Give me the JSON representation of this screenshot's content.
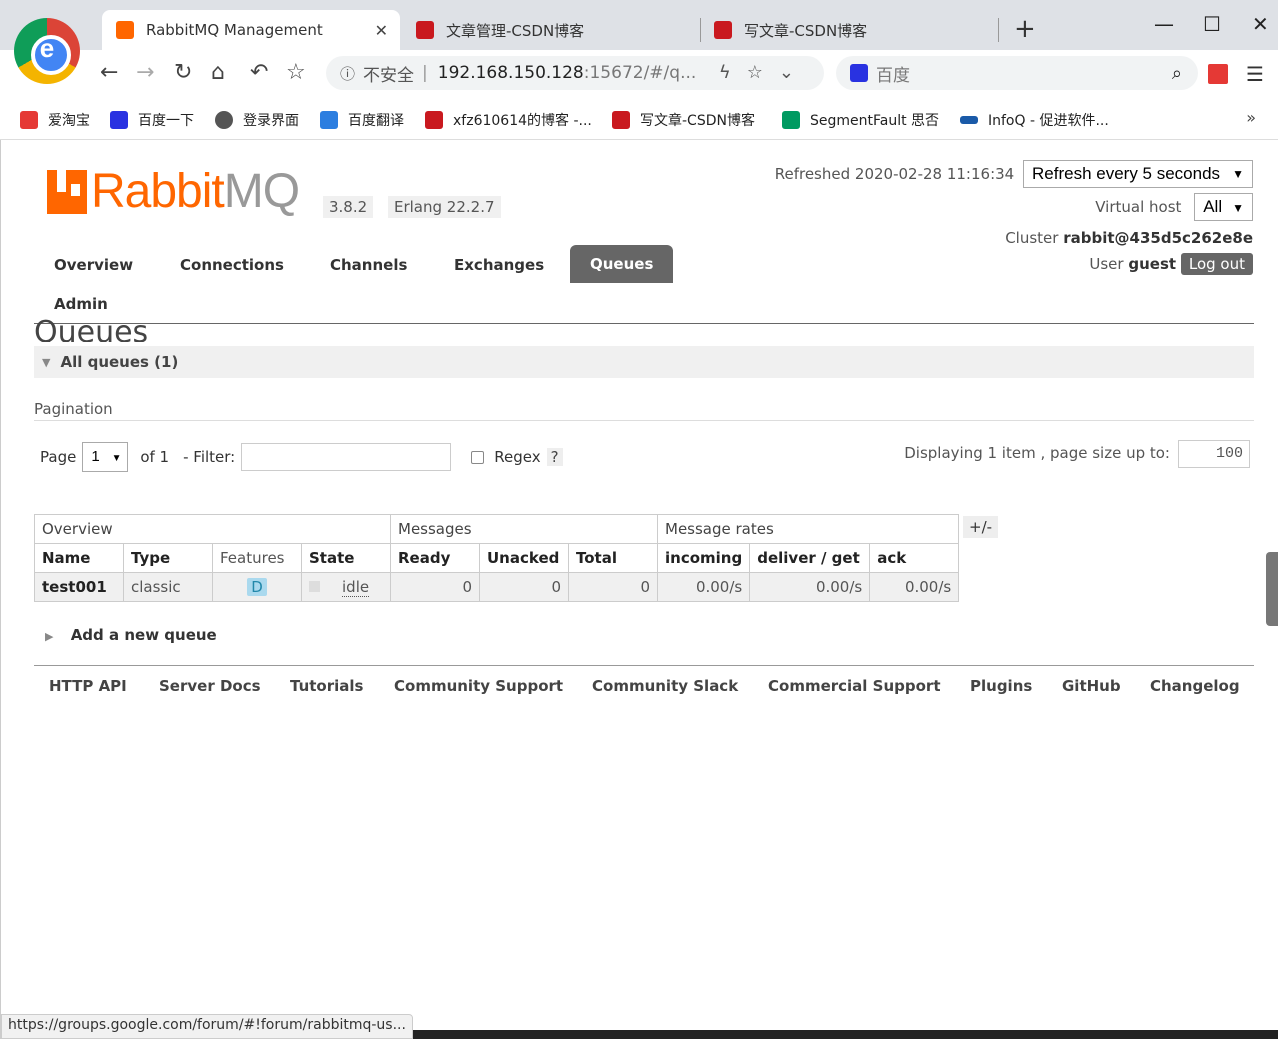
{
  "browser": {
    "tabs": [
      {
        "title": "RabbitMQ Management",
        "active": true
      },
      {
        "title": "文章管理-CSDN博客",
        "active": false
      },
      {
        "title": "写文章-CSDN博客",
        "active": false
      }
    ],
    "tab_close": "✕",
    "new_tab": "+",
    "window_controls": {
      "minimize": "—",
      "maximize": "☐",
      "close": "✕"
    },
    "address": {
      "security_label": "不安全",
      "host": "192.168.150.128",
      "path": ":15672/#/q..."
    },
    "search_placeholder": "百度",
    "bookmarks": [
      "爱淘宝",
      "百度一下",
      "登录界面",
      "百度翻译",
      "xfz610614的博客 -...",
      "写文章-CSDN博客",
      "SegmentFault 思否",
      "InfoQ - 促进软件..."
    ],
    "bookmarks_more": "»",
    "status_url": "https://groups.google.com/forum/#!forum/rabbitmq-us..."
  },
  "header": {
    "logo_main": "Rabbit",
    "logo_mq": "MQ",
    "version": "3.8.2",
    "erlang": "Erlang 22.2.7",
    "refreshed": "Refreshed 2020-02-28 11:16:34",
    "refresh_select": "Refresh every 5 seconds",
    "vhost_label": "Virtual host",
    "vhost_select": "All",
    "cluster_label": "Cluster",
    "cluster_name": "rabbit@435d5c262e8e",
    "user_label": "User",
    "user_name": "guest",
    "logout": "Log out"
  },
  "nav": [
    "Overview",
    "Connections",
    "Channels",
    "Exchanges",
    "Queues",
    "Admin"
  ],
  "main": {
    "title": "Queues",
    "section": "All queues (1)",
    "pagination_label": "Pagination",
    "page_label": "Page",
    "page_value": "1",
    "of_label": "of 1",
    "filter_label": "- Filter:",
    "regex_label": "Regex",
    "help": "?",
    "displaying": "Displaying 1 item , page size up to:",
    "page_size": "100",
    "plus_minus": "+/-",
    "add_queue": "Add a new queue"
  },
  "table": {
    "groups": [
      "Overview",
      "Messages",
      "Message rates"
    ],
    "columns": [
      "Name",
      "Type",
      "Features",
      "State",
      "Ready",
      "Unacked",
      "Total",
      "incoming",
      "deliver / get",
      "ack"
    ],
    "rows": [
      {
        "name": "test001",
        "type": "classic",
        "features": "D",
        "state": "idle",
        "ready": "0",
        "unacked": "0",
        "total": "0",
        "incoming": "0.00/s",
        "deliver_get": "0.00/s",
        "ack": "0.00/s"
      }
    ]
  },
  "footer": [
    "HTTP API",
    "Server Docs",
    "Tutorials",
    "Community Support",
    "Community Slack",
    "Commercial Support",
    "Plugins",
    "GitHub",
    "Changelog"
  ],
  "colors": {
    "brand": "#ff6600",
    "nav_active": "#666666"
  }
}
